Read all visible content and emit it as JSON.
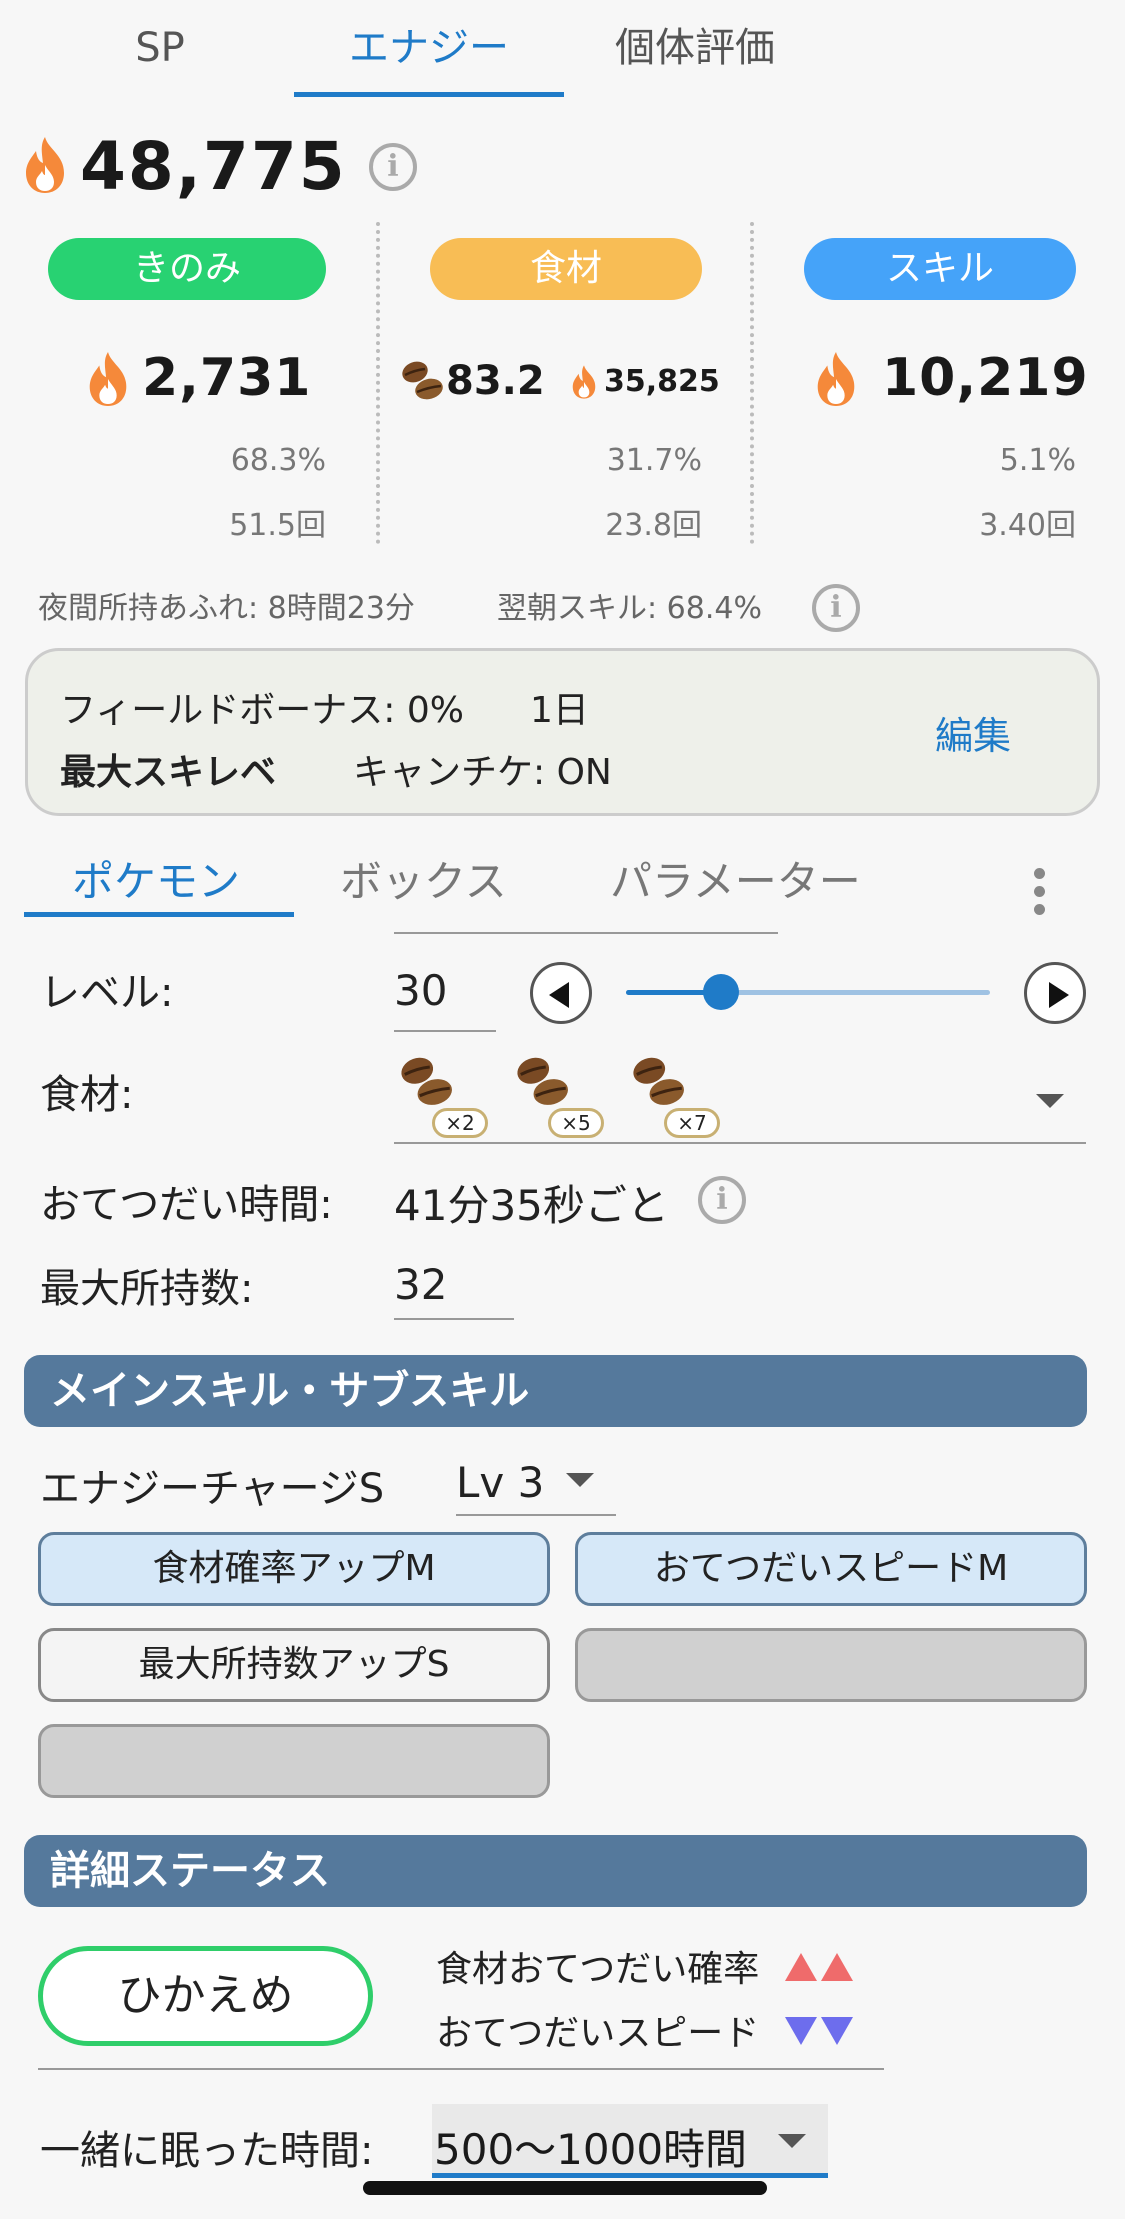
{
  "top_tabs": [
    "SP",
    "エナジー",
    "個体評価"
  ],
  "total_energy": "48,775",
  "categories": {
    "berry": {
      "label": "きのみ",
      "energy": "2,731",
      "percent": "68.3%",
      "count": "51.5回",
      "color": "#28d272"
    },
    "ingredient": {
      "label": "食材",
      "amount": "83.2",
      "energy": "35,825",
      "percent": "31.7%",
      "count": "23.8回",
      "color": "#f8bd55"
    },
    "skill": {
      "label": "スキル",
      "energy": "10,219",
      "percent": "5.1%",
      "count": "3.40回",
      "color": "#45a3f9"
    }
  },
  "notes": {
    "night_overflow": "夜間所持あふれ: 8時間23分",
    "morning_skill": "翌朝スキル: 68.4%"
  },
  "settings": {
    "field_bonus": "フィールドボーナス: 0%",
    "period": "1日",
    "max_skill_level": "最大スキレベ",
    "candy_ticket": "キャンチケ: ON",
    "edit": "編集"
  },
  "sub_tabs": [
    "ポケモン",
    "ボックス",
    "パラメーター"
  ],
  "form": {
    "level_label": "レベル:",
    "level_value": "30",
    "level_fraction": 0.26,
    "ingredient_label": "食材:",
    "ingredients": [
      {
        "icon": "coffee-bean-icon",
        "mult": "×2"
      },
      {
        "icon": "coffee-bean-icon",
        "mult": "×5"
      },
      {
        "icon": "coffee-bean-icon",
        "mult": "×7"
      }
    ],
    "help_time_label": "おてつだい時間:",
    "help_time_value": "41分35秒ごと",
    "max_carry_label": "最大所持数:",
    "max_carry_value": "32"
  },
  "skills_section": {
    "title": "メインスキル・サブスキル",
    "main_skill": "エナジーチャージS",
    "main_skill_level": "Lv 3",
    "sub_skills": [
      "食材確率アップM",
      "おてつだいスピードM",
      "最大所持数アップS",
      "",
      ""
    ]
  },
  "detail_section": {
    "title": "詳細ステータス",
    "nature": "ひかえめ",
    "up_effect": "食材おてつだい確率",
    "down_effect": "おてつだいスピード",
    "sleep_label": "一緒に眠った時間:",
    "sleep_value": "500〜1000時間"
  }
}
